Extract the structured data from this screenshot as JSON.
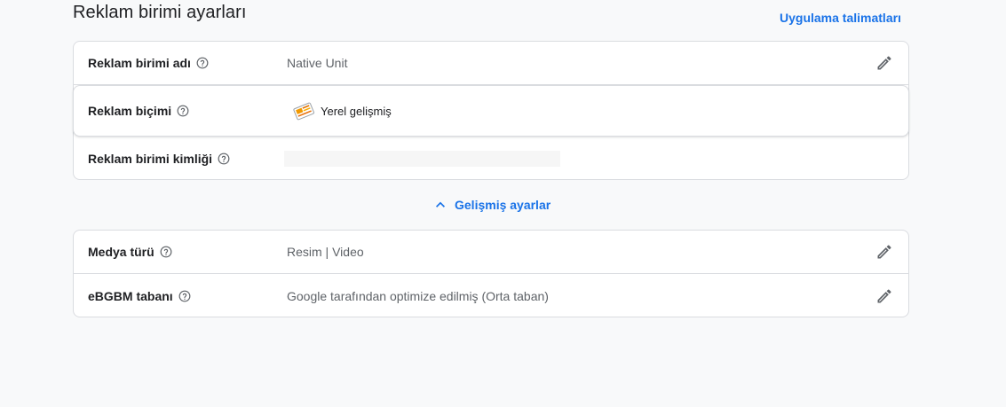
{
  "header": {
    "title": "Reklam birimi ayarları",
    "instructions_link": "Uygulama talimatları"
  },
  "settings": [
    {
      "label": "Reklam birimi adı",
      "value": "Native Unit"
    },
    {
      "label": "Reklam biçimi",
      "value": "Yerel gelişmiş"
    },
    {
      "label": "Reklam birimi kimliği",
      "value": ""
    }
  ],
  "advanced": {
    "toggle_label": "Gelişmiş ayarlar",
    "state": "expanded"
  },
  "advanced_settings": [
    {
      "label": "Medya türü",
      "value": "Resim | Video"
    },
    {
      "label": "eBGBM tabanı",
      "value": "Google tarafından optimize edilmiş (Orta taban)"
    }
  ],
  "icons": {
    "help": "help-circle-icon",
    "edit": "pencil-icon",
    "format": "native-ad-format-icon",
    "toggle": "chevron-up-icon"
  },
  "colors": {
    "accent": "#1a73e8",
    "icon": "#5f6368",
    "border": "#dadce0",
    "background": "#f8f9fa"
  }
}
